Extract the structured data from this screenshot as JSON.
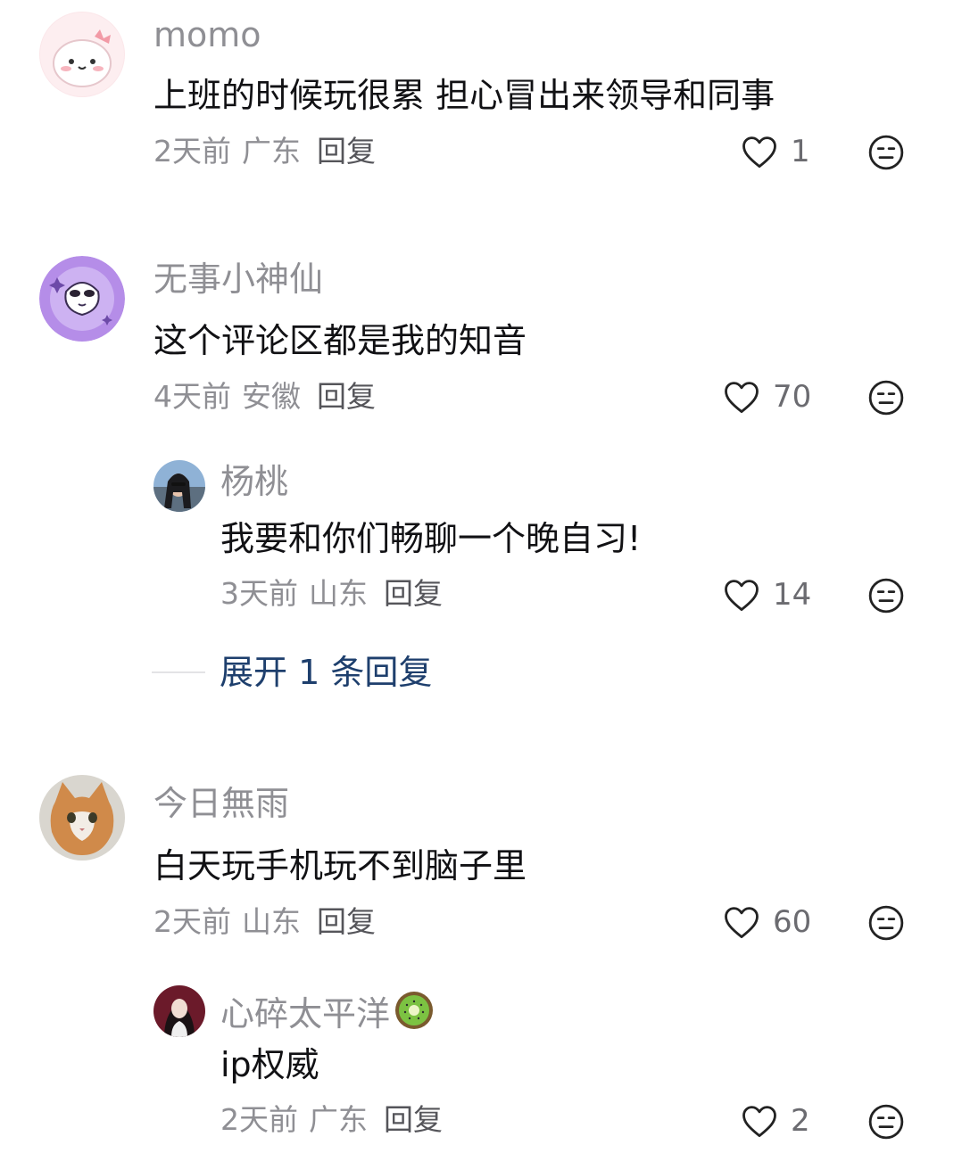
{
  "comments": [
    {
      "username": "momo",
      "text": "上班的时候玩很累 担心冒出来领导和同事",
      "time": "2天前",
      "region": "广东",
      "reply_label": "回复",
      "likes": "1"
    },
    {
      "username": "无事小神仙",
      "text": "这个评论区都是我的知音",
      "time": "4天前",
      "region": "安徽",
      "reply_label": "回复",
      "likes": "70",
      "replies": [
        {
          "username": "杨桃",
          "text": "我要和你们畅聊一个晚自习!",
          "time": "3天前",
          "region": "山东",
          "reply_label": "回复",
          "likes": "14"
        }
      ],
      "expand_label": "展开 1 条回复"
    },
    {
      "username": "今日無雨",
      "text": "白天玩手机玩不到脑子里",
      "time": "2天前",
      "region": "山东",
      "reply_label": "回复",
      "likes": "60",
      "replies": [
        {
          "username": "心碎太平洋",
          "username_emoji": "kiwi-emoji",
          "text": "ip权威",
          "time": "2天前",
          "region": "广东",
          "reply_label": "回复",
          "likes": "2"
        }
      ]
    }
  ],
  "icons": {
    "like": "heart-outline-icon",
    "dislike": "unamused-face-icon"
  },
  "colors": {
    "username": "#8f8f94",
    "text": "#111114",
    "meta": "#8f8f94",
    "link": "#1e3f6d"
  }
}
